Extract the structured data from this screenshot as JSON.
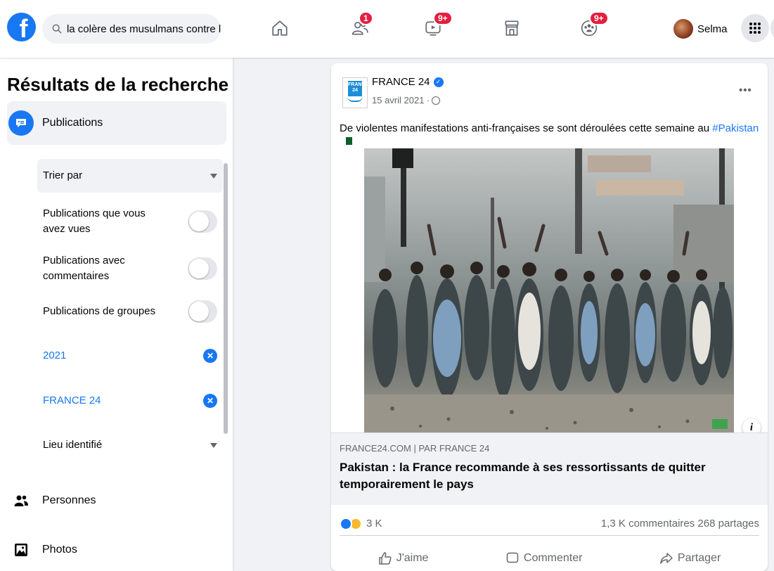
{
  "topbar": {
    "search_value": "la colère des musulmans contre les",
    "badges": {
      "friends": "1",
      "watch": "9+",
      "groups": "9+"
    },
    "profile_name": "Selma"
  },
  "sidebar": {
    "title": "Résultats de la recherche",
    "categories": {
      "publications": "Publications",
      "people": "Personnes",
      "photos": "Photos"
    },
    "filters": {
      "sort_by": "Trier par",
      "seen_posts": "Publications que vous avez vues",
      "with_comments": "Publications avec commentaires",
      "group_posts": "Publications de groupes",
      "year": "2021",
      "source": "FRANCE 24",
      "tagged_location": "Lieu identifié"
    }
  },
  "post": {
    "page_name": "FRANCE 24",
    "page_logo_text": "FRANCE 24",
    "date": "15 avril 2021 ·",
    "text_prefix": "De violentes manifestations anti-françaises se sont déroulées cette semaine au ",
    "hashtag": "#Pakistan",
    "link_domain": "FRANCE24.COM | PAR FRANCE 24",
    "link_title": "Pakistan : la France recommande à ses ressortissants de quitter temporairement le pays",
    "reaction_count": "3 K",
    "comments_shares": "1,3 K commentaires 268 partages",
    "actions": {
      "like": "J'aime",
      "comment": "Commenter",
      "share": "Partager"
    }
  },
  "colors": {
    "facebook_blue": "#1877f2",
    "badge_red": "#e41e3f",
    "background": "#f0f2f5"
  },
  "icons": [
    "facebook-logo-icon",
    "search-icon",
    "home-icon",
    "friends-icon",
    "watch-icon",
    "marketplace-icon",
    "groups-icon",
    "menu-grid-icon",
    "publications-icon",
    "people-icon",
    "photos-icon",
    "verified-icon",
    "globe-icon",
    "more-icon",
    "info-icon",
    "like-icon",
    "comment-icon",
    "share-icon",
    "flag-icon"
  ]
}
